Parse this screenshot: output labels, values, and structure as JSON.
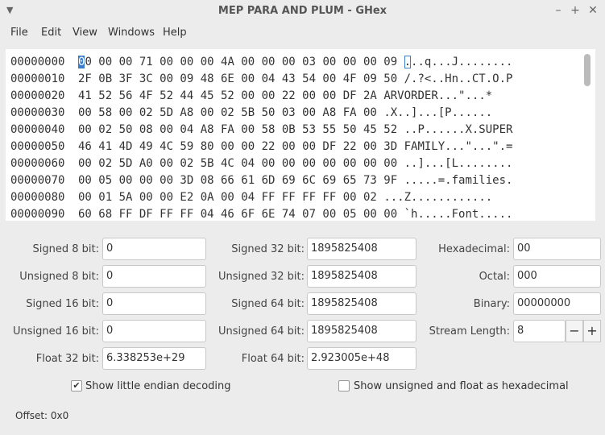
{
  "window": {
    "title": "MEP PARA AND PLUM - GHex"
  },
  "menu": [
    "File",
    "Edit",
    "View",
    "Windows",
    "Help"
  ],
  "hex_rows": [
    {
      "offset": "00000000",
      "hex": "00 00 00 71 00 00 00 4A 00 00 00 03 00 00 00 09",
      "ascii": "...q...J........"
    },
    {
      "offset": "00000010",
      "hex": "2F 0B 3F 3C 00 09 48 6E 00 04 43 54 00 4F 09 50",
      "ascii": "/.?<..Hn..CT.O.P"
    },
    {
      "offset": "00000020",
      "hex": "41 52 56 4F 52 44 45 52 00 00 22 00 00 DF 2A",
      "ascii": "ARVORDER...\"...*"
    },
    {
      "offset": "00000030",
      "hex": "00 58 00 02 5D A8 00 02 5B 50 03 00 A8 FA 00",
      "ascii": ".X..]...[P......"
    },
    {
      "offset": "00000040",
      "hex": "00 02 50 08 00 04 A8 FA 00 58 0B 53 55 50 45 52",
      "ascii": "..P......X.SUPER"
    },
    {
      "offset": "00000050",
      "hex": "46 41 4D 49 4C 59 80 00 00 22 00 00 DF 22 00 3D",
      "ascii": "FAMILY...\"...\".="
    },
    {
      "offset": "00000060",
      "hex": "00 02 5D A0 00 02 5B 4C 04 00 00 00 00 00 00 00",
      "ascii": "..]...[L........"
    },
    {
      "offset": "00000070",
      "hex": "00 05 00 00 00 3D 08 66 61 6D 69 6C 69 65 73 9F",
      "ascii": ".....=.families."
    },
    {
      "offset": "00000080",
      "hex": "00 01 5A 00 00 E2 0A 00 04 FF FF FF FF 00 02",
      "ascii": "...Z............"
    },
    {
      "offset": "00000090",
      "hex": "60 68 FF DF FF FF 04 46 6F 6E 74 07 00 05 00 00",
      "ascii": "`h.....Font....."
    }
  ],
  "inspector": {
    "signed8": {
      "label": "Signed 8 bit:",
      "value": "0"
    },
    "unsigned8": {
      "label": "Unsigned 8 bit:",
      "value": "0"
    },
    "signed16": {
      "label": "Signed 16 bit:",
      "value": "0"
    },
    "unsigned16": {
      "label": "Unsigned 16 bit:",
      "value": "0"
    },
    "float32": {
      "label": "Float 32 bit:",
      "value": "6.338253e+29"
    },
    "signed32": {
      "label": "Signed 32 bit:",
      "value": "1895825408"
    },
    "unsigned32": {
      "label": "Unsigned 32 bit:",
      "value": "1895825408"
    },
    "signed64": {
      "label": "Signed 64 bit:",
      "value": "1895825408"
    },
    "unsigned64": {
      "label": "Unsigned 64 bit:",
      "value": "1895825408"
    },
    "float64": {
      "label": "Float 64 bit:",
      "value": "2.923005e+48"
    },
    "hexadecimal": {
      "label": "Hexadecimal:",
      "value": "00"
    },
    "octal": {
      "label": "Octal:",
      "value": "000"
    },
    "binary": {
      "label": "Binary:",
      "value": "00000000"
    },
    "stream_length": {
      "label": "Stream Length:",
      "value": "8",
      "minus": "−",
      "plus": "+"
    }
  },
  "options": {
    "little_endian": {
      "label": "Show little endian decoding",
      "checked": true
    },
    "unsigned_hex": {
      "label": "Show unsigned and float as hexadecimal",
      "checked": false
    }
  },
  "status": {
    "offset": "Offset: 0x0"
  },
  "colors": {
    "cursor": "#3d7cc9"
  }
}
